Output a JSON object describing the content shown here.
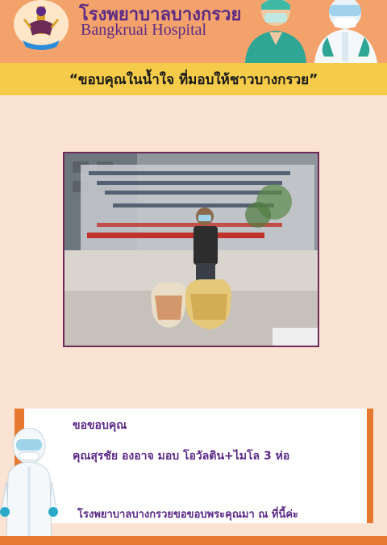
{
  "header": {
    "hospital_name_th": "โรงพยาบาลบางกรวย",
    "hospital_name_en": "Bangkruai Hospital",
    "logo_icon": "hospital-emblem-icon",
    "illustration_icon": "medical-staff-illustration-icon"
  },
  "banner": {
    "text": "“ขอบคุณในน้ำใจ ที่มอบให้ชาวบางกรวย”"
  },
  "photo": {
    "icon": "donation-photo-icon"
  },
  "message": {
    "title": "ขอขอบคุณ",
    "donor_line": "คุณสุรชัย องอาจ มอบ โอวัลติน+ไมโล 3 ห่อ",
    "closing": "โรงพยาบาลบางกรวยขอขอบพระคุณมา ณ ที่นี้ค่ะ"
  },
  "colors": {
    "header_bg": "#f3a26b",
    "banner_bg": "#f5cc4a",
    "page_bg": "#fbe3d4",
    "accent_orange": "#e6782f",
    "text_purple": "#5b2a86"
  }
}
